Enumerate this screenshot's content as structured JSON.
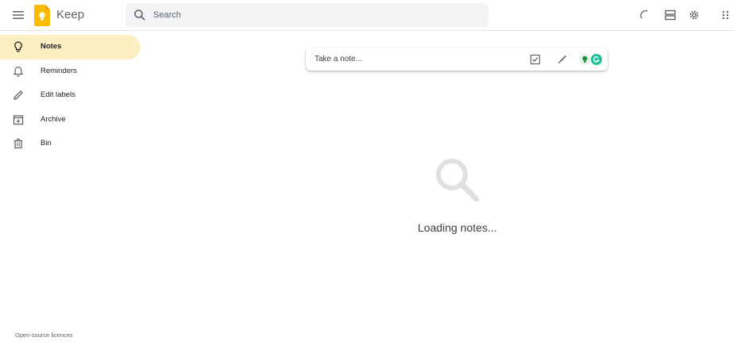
{
  "app": {
    "title": "Keep"
  },
  "search": {
    "placeholder": "Search"
  },
  "sidebar": {
    "items": [
      {
        "label": "Notes",
        "icon": "lightbulb-icon",
        "active": true
      },
      {
        "label": "Reminders",
        "icon": "bell-icon",
        "active": false
      },
      {
        "label": "Edit labels",
        "icon": "pencil-icon",
        "active": false
      },
      {
        "label": "Archive",
        "icon": "archive-icon",
        "active": false
      },
      {
        "label": "Bin",
        "icon": "trash-icon",
        "active": false
      }
    ]
  },
  "take_note": {
    "placeholder": "Take a note..."
  },
  "loading": {
    "text": "Loading notes..."
  },
  "footer": {
    "link": "Open-source licences"
  },
  "colors": {
    "active_nav_bg": "#feefc3",
    "logo_yellow": "#fbbc04",
    "grammarly_green": "#15c39a",
    "icon_gray": "#5f6368"
  }
}
